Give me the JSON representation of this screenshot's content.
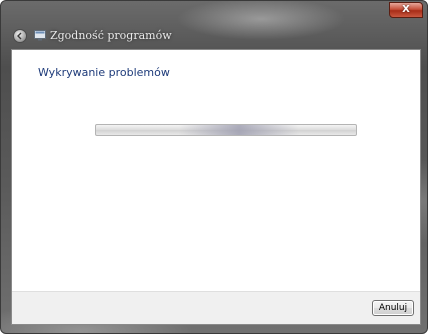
{
  "window": {
    "title": "Zgodność programów",
    "close_glyph": "X"
  },
  "content": {
    "heading": "Wykrywanie problemów",
    "progress": {
      "mode": "indeterminate",
      "highlight_position": 0.55
    }
  },
  "footer": {
    "cancel_label": "Anuluj"
  },
  "icons": {
    "back": "back-arrow-icon",
    "app": "app-icon",
    "close": "close-icon"
  },
  "colors": {
    "heading": "#1e3b7a",
    "close_button": "#c7503a",
    "footer_bg": "#f0f0f0"
  }
}
